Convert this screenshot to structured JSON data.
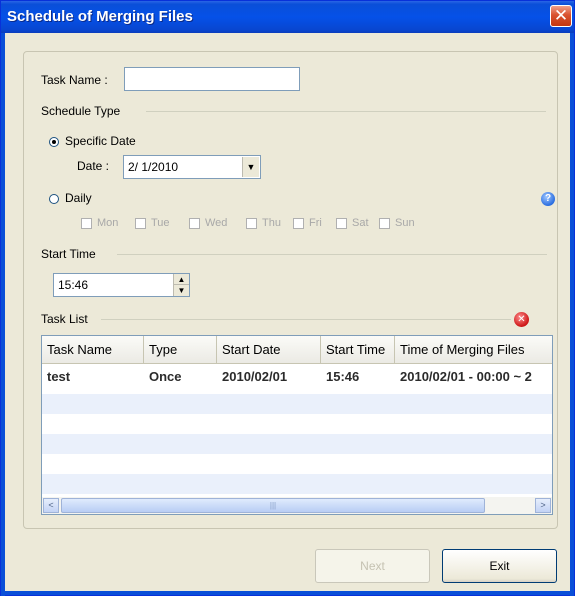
{
  "window": {
    "title": "Schedule of Merging Files",
    "close_glyph": "✕"
  },
  "task_name": {
    "label": "Task Name :",
    "value": ""
  },
  "schedule_type": {
    "legend": "Schedule Type",
    "specific_date_label": "Specific Date",
    "specific_date_selected": true,
    "date_label": "Date :",
    "date_value": "2/ 1/2010",
    "daily_label": "Daily",
    "days": [
      "Mon",
      "Tue",
      "Wed",
      "Thu",
      "Fri",
      "Sat",
      "Sun"
    ],
    "help_glyph": "?"
  },
  "start_time": {
    "legend": "Start Time",
    "value": "15:46"
  },
  "task_list": {
    "legend": "Task List",
    "delete_glyph": "✕",
    "columns": [
      "Task Name",
      "Type",
      "Start Date",
      "Start Time",
      "Time of Merging Files"
    ],
    "rows": [
      [
        "test",
        "Once",
        "2010/02/01",
        "15:46",
        "2010/02/01 - 00:00 ~ 2"
      ]
    ],
    "scroll_left_glyph": "<",
    "scroll_right_glyph": ">",
    "scroll_thumb_grip": "|||"
  },
  "buttons": {
    "next": "Next",
    "exit": "Exit"
  },
  "colors": {
    "titlebar": "#0551e8",
    "dialog_bg": "#ece9d8",
    "row_alt": "#eaf0fb"
  }
}
